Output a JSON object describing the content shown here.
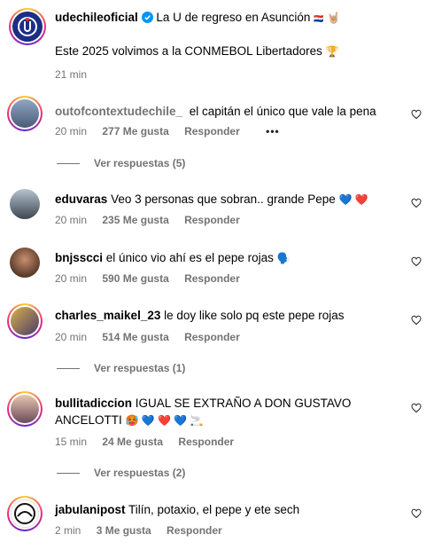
{
  "post": {
    "username": "udechileoficial",
    "caption_line1": "La U de regreso en Asunción",
    "flag": "🇵🇾",
    "hand": "🤘🏼",
    "caption_line2": "Este 2025 volvimos a la CONMEBOL Libertadores",
    "trophy": "🏆",
    "time": "21 min"
  },
  "comments": [
    {
      "username": "outofcontextudechile_",
      "text": "el capitán el único que vale la pena",
      "time": "20 min",
      "likes": "277 Me gusta",
      "reply": "Responder",
      "more": "•••",
      "view_replies": "Ver respuestas (5)"
    },
    {
      "username": "eduvaras",
      "text": "Veo 3 personas que sobran.. grande Pepe",
      "emojis": "💙 ❤️",
      "time": "20 min",
      "likes": "235 Me gusta",
      "reply": "Responder"
    },
    {
      "username": "bnjsscci",
      "text": "el único vio ahí es el pepe rojas",
      "emojis": "🗣️",
      "time": "20 min",
      "likes": "590 Me gusta",
      "reply": "Responder"
    },
    {
      "username": "charles_maikel_23",
      "text": "le doy like solo pq este pepe rojas",
      "time": "20 min",
      "likes": "514 Me gusta",
      "reply": "Responder",
      "view_replies": "Ver respuestas (1)"
    },
    {
      "username": "bullitadiccion",
      "text": "IGUAL SE EXTRAÑO A DON GUSTAVO",
      "text2": "ANCELOTTI",
      "emojis": "🥵 💙 ❤️ 💙 🚬",
      "time": "15 min",
      "likes": "24 Me gusta",
      "reply": "Responder",
      "view_replies": "Ver respuestas (2)"
    },
    {
      "username": "jabulanipost",
      "text": "Tilín, potaxio, el pepe y ete sech",
      "time": "2 min",
      "likes": "3 Me gusta",
      "reply": "Responder"
    }
  ]
}
